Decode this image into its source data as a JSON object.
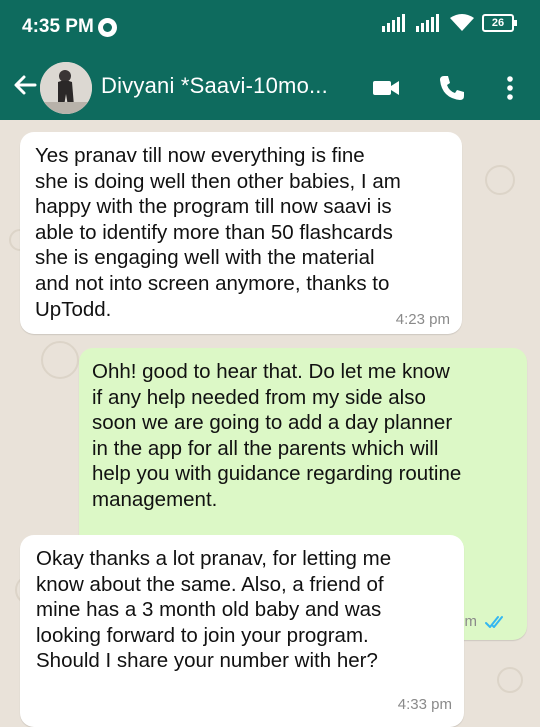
{
  "status_bar": {
    "time": "4:35 PM",
    "battery": "26"
  },
  "header": {
    "contact_name": "Divyani *Saavi-10mo..."
  },
  "messages": [
    {
      "direction": "incoming",
      "text": "Yes pranav till now everything is fine\nshe is doing well then other babies, I am\nhappy with the program till now saavi is\nable to identify more than 50 flashcards\nshe is engaging well with the material\nand not into screen anymore, thanks to\nUpTodd.",
      "time": "4:23 pm"
    },
    {
      "direction": "outgoing",
      "text": "Ohh! good to hear that. Do let me know\nif any help needed from my side also\nsoon we are going to add a day planner\nin the app for all the parents which will\nhelp you with guidance regarding routine\nmanagement.",
      "time": "4:29 pm",
      "status": "read"
    },
    {
      "direction": "incoming",
      "text": "Okay thanks a lot pranav, for letting me\nknow about the same. Also, a friend of\nmine has a 3 month old baby and was\nlooking forward to join your program.\nShould I share your number with her?",
      "time": "4:33 pm"
    }
  ],
  "colors": {
    "header": "#0e6b5e",
    "incoming_bubble": "#ffffff",
    "outgoing_bubble": "#dcf8c6",
    "read_tick": "#34b7f1"
  }
}
